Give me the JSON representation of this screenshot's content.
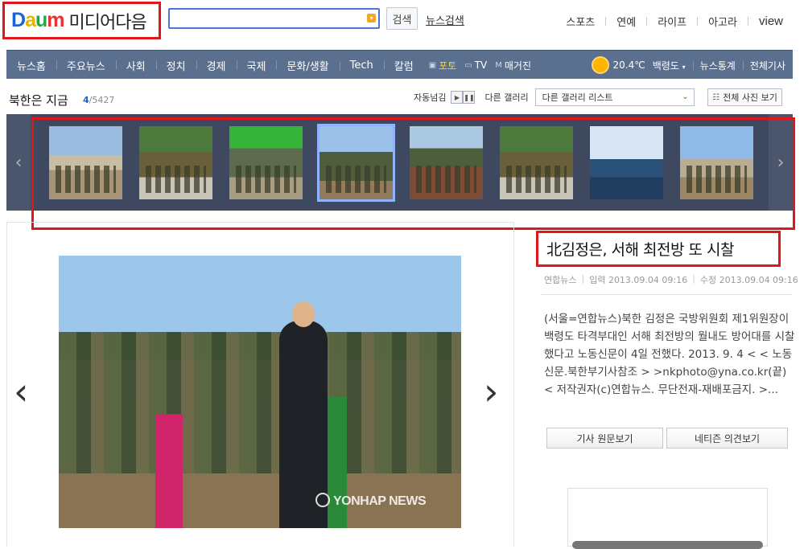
{
  "header": {
    "logo_parts": [
      "D",
      "a",
      "u",
      "m"
    ],
    "logo_sub": "미디어다음",
    "search_placeholder": "",
    "search_button": "검색",
    "news_search": "뉴스검색",
    "top_links": [
      "스포츠",
      "연예",
      "라이프",
      "아고라",
      "view"
    ]
  },
  "nav": {
    "items": [
      "뉴스홈",
      "주요뉴스",
      "사회",
      "정치",
      "경제",
      "국제",
      "문화/생활",
      "Tech",
      "칼럼"
    ],
    "media": [
      {
        "icon": "photo-icon",
        "label": "포토"
      },
      {
        "icon": "tv-icon",
        "label": "TV"
      },
      {
        "icon": "magazine-icon",
        "label": "매거진"
      }
    ],
    "weather": {
      "temp": "20.4℃",
      "place": "백령도"
    },
    "right_links": [
      "뉴스통계",
      "전체기사"
    ]
  },
  "gallery": {
    "title": "북한은 지금",
    "current": "4",
    "total": "/5427",
    "autoplay_label": "자동넘김",
    "other_gallery_label": "다른 갤러리",
    "select_value": "다른 갤러리 리스트",
    "all_photos": "전체 사진 보기",
    "thumbs": 8,
    "active_thumb": 4
  },
  "article": {
    "title": "北김정은, 서해 최전방 또 시찰",
    "source": "연합뉴스",
    "posted": "입력 2013.09.04 09:16",
    "modified": "수정 2013.09.04 09:16",
    "body": "(서울=연합뉴스)북한 김정은 국방위원회 제1위원장이 백령도 타격부대인 서해 최전방의 월내도 방어대를 시찰했다고 노동신문이 4일 전했다. 2013. 9. 4 < < 노동신문.북한부기사참조 > >nkphoto@yna.co.kr(끝)< 저작권자(c)연합뉴스. 무단전재-재배포금지. >...",
    "button_original": "기사 원문보기",
    "button_comments": "네티즌 의견보기",
    "watermark": "YONHAP NEWS"
  },
  "colors": {
    "accent": "#e0161d",
    "nav_bg": "#5b708f",
    "strip_bg": "#3e4960",
    "link_blue": "#1e63d6"
  }
}
